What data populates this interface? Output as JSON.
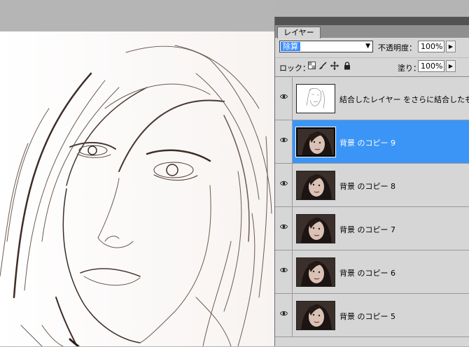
{
  "panel": {
    "tab_label": "レイヤー",
    "blend_mode": "除算",
    "opacity_label": "不透明度：",
    "opacity_value": "100%",
    "lock_label": "ロック：",
    "fill_label": "塗り：",
    "fill_value": "100%"
  },
  "layers": [
    {
      "name": "結合したレイヤー をさらに結合したもの",
      "selected": false,
      "thumb": "sketch"
    },
    {
      "name": "背景 のコピー 9",
      "selected": true,
      "thumb": "photo"
    },
    {
      "name": "背景 のコピー 8",
      "selected": false,
      "thumb": "photo"
    },
    {
      "name": "背景 のコピー 7",
      "selected": false,
      "thumb": "photo"
    },
    {
      "name": "背景 のコピー 6",
      "selected": false,
      "thumb": "photo"
    },
    {
      "name": "背景 のコピー 5",
      "selected": false,
      "thumb": "photo"
    }
  ],
  "colors": {
    "selection": "#3b95f7",
    "panel_bg": "#d6d6d6"
  }
}
